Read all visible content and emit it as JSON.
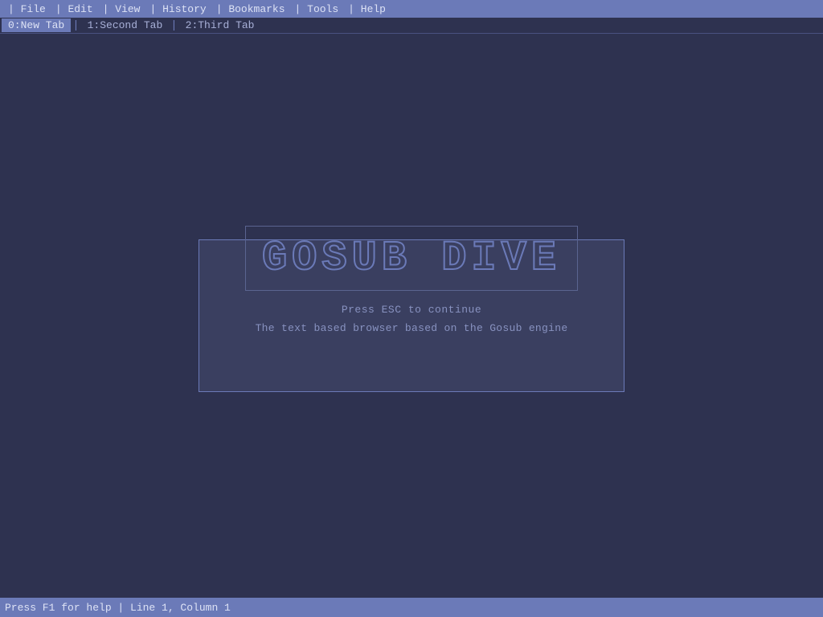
{
  "menubar": {
    "items": [
      "File",
      "Edit",
      "View",
      "History",
      "Bookmarks",
      "Tools",
      "Help"
    ]
  },
  "tabs": [
    {
      "id": "0",
      "label": "0:New Tab",
      "active": true
    },
    {
      "id": "1",
      "label": "1:Second Tab",
      "active": false
    },
    {
      "id": "2",
      "label": "2:Third Tab",
      "active": false
    }
  ],
  "splash": {
    "logo_text": "GOSUB DIVE",
    "subtitle": "Press ESC to continue",
    "tagline": "The text based browser based on the Gosub engine"
  },
  "statusbar": {
    "text": "Press F1 for help | Line 1, Column 1"
  }
}
